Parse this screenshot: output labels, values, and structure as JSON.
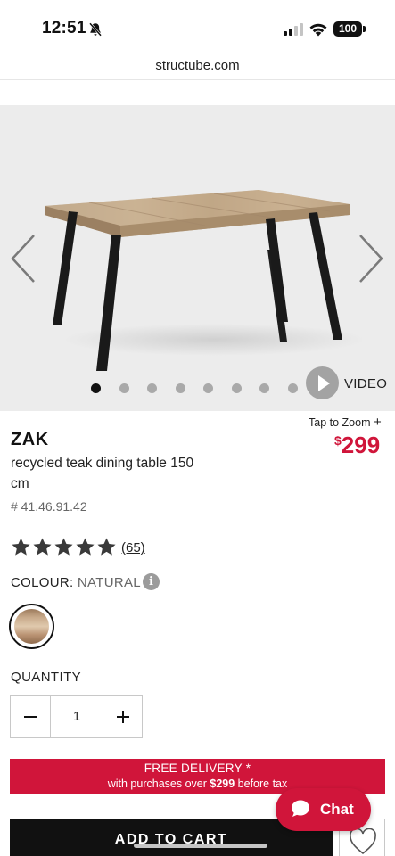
{
  "status_bar": {
    "time": "12:51",
    "battery": "100",
    "icons": [
      "bell-slash-icon",
      "cellular-signal-icon",
      "wifi-icon",
      "battery-icon"
    ]
  },
  "browser": {
    "url": "structube.com"
  },
  "gallery": {
    "image": "recycled-teak-dining-table-photo",
    "dot_count": 8,
    "active_dot": 1,
    "video_label": "VIDEO"
  },
  "product": {
    "tap_to_zoom": "Tap to Zoom",
    "brand": "ZAK",
    "name": "recycled teak dining table 150 cm",
    "sku": "# 41.46.91.42",
    "price_currency": "$",
    "price_amount": "299",
    "rating": 5,
    "review_count": "(65)",
    "colour_label": "COLOUR:",
    "colour_value": "NATURAL",
    "info_icon": "i",
    "quantity_label": "QUANTITY",
    "quantity": "1"
  },
  "promo": {
    "line1": "FREE DELIVERY *",
    "line2_prefix": "with purchases over ",
    "line2_amount": "$299",
    "line2_suffix": " before tax"
  },
  "actions": {
    "add_to_cart": "ADD TO CART",
    "chat": "Chat"
  },
  "colors": {
    "brand_red": "#d0153a",
    "dark": "#111111",
    "gallery_bg": "#ececec"
  }
}
